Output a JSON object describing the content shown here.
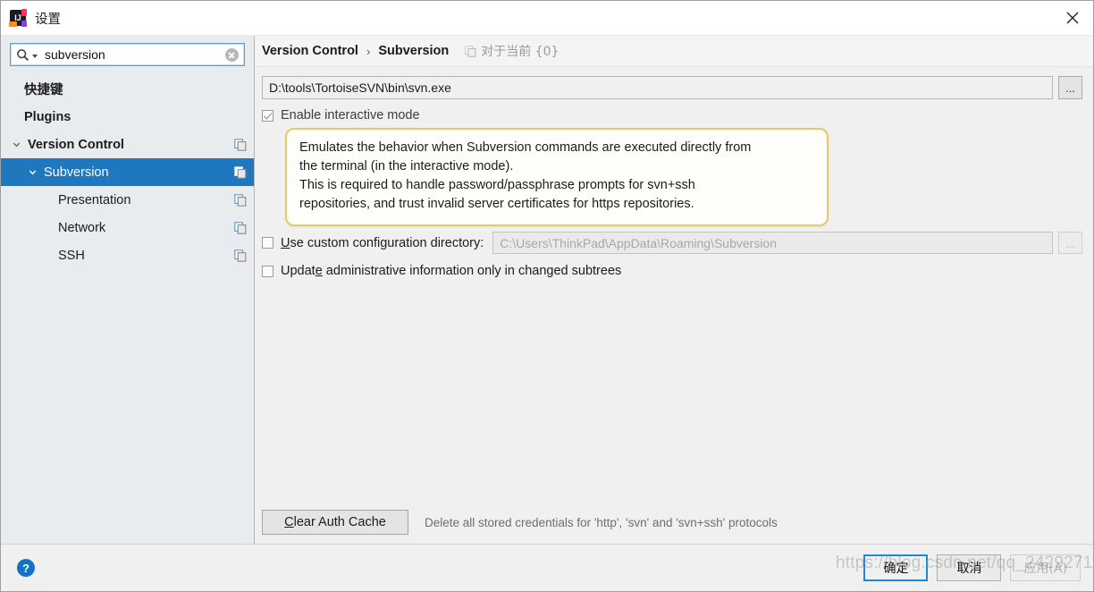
{
  "window": {
    "title": "设置",
    "app_icon": "intellij-idea-icon",
    "close_icon": "close-icon"
  },
  "search": {
    "value": "subversion",
    "placeholder": "",
    "icon": "search-icon",
    "clear_icon": "clear-icon"
  },
  "sidebar": {
    "items": [
      {
        "label": "快捷键",
        "indent": 1,
        "bold": true,
        "cjk": true,
        "arrow": "",
        "selected": false,
        "copy_icon": false
      },
      {
        "label": "Plugins",
        "indent": 1,
        "bold": true,
        "cjk": false,
        "arrow": "",
        "selected": false,
        "copy_icon": false
      },
      {
        "label": "Version Control",
        "indent": 0,
        "bold": true,
        "cjk": false,
        "arrow": "down",
        "selected": false,
        "copy_icon": true
      },
      {
        "label": "Subversion",
        "indent": 1,
        "bold": false,
        "cjk": false,
        "arrow": "down",
        "selected": true,
        "copy_icon": true
      },
      {
        "label": "Presentation",
        "indent": 2,
        "bold": false,
        "cjk": false,
        "arrow": "",
        "selected": false,
        "copy_icon": true
      },
      {
        "label": "Network",
        "indent": 2,
        "bold": false,
        "cjk": false,
        "arrow": "",
        "selected": false,
        "copy_icon": true
      },
      {
        "label": "SSH",
        "indent": 2,
        "bold": false,
        "cjk": false,
        "arrow": "",
        "selected": false,
        "copy_icon": true
      }
    ]
  },
  "breadcrumb": {
    "root": "Version Control",
    "separator": "›",
    "current": "Subversion",
    "note": "对于当前 {0}",
    "note_icon": "copy-icon"
  },
  "main": {
    "svn_path": {
      "value": "D:\\tools\\TortoiseSVN\\bin\\svn.exe",
      "browse_label": "..."
    },
    "interactive": {
      "label": "Enable interactive mode",
      "checked": true
    },
    "tooltip": {
      "line1": "Emulates the behavior when Subversion commands are executed directly from",
      "line2": "the terminal (in the interactive mode).",
      "line3": "This is required to handle password/passphrase prompts for svn+ssh",
      "line4": "repositories, and trust invalid server certificates for https repositories.",
      "border_color": "#e8c96a"
    },
    "custom_config": {
      "mnemonic": "U",
      "label_rest": "se custom configuration directory:",
      "checked": false,
      "value": "C:\\Users\\ThinkPad\\AppData\\Roaming\\Subversion",
      "browse_label": "..."
    },
    "update_admin": {
      "label_pre": "Updat",
      "mnemonic": "e",
      "label_rest": " administrative information only in changed subtrees",
      "checked": false
    },
    "clear_auth": {
      "mnemonic": "C",
      "label_rest": "lear Auth Cache",
      "note": "Delete all stored credentials for 'http', 'svn' and 'svn+ssh' protocols"
    }
  },
  "footer": {
    "help_icon": "help-icon",
    "help_glyph": "?",
    "ok_label": "确定",
    "cancel_label": "取消",
    "apply_label": "应用(A)"
  },
  "watermark": {
    "text": "https://blog.csdn.net/qq_24292711"
  },
  "colors": {
    "accent": "#1f78be",
    "selection": "#1f78be",
    "sidebar_bg": "#e8ecef",
    "tooltip_border": "#e8c96a",
    "help_blue": "#1672c4"
  }
}
